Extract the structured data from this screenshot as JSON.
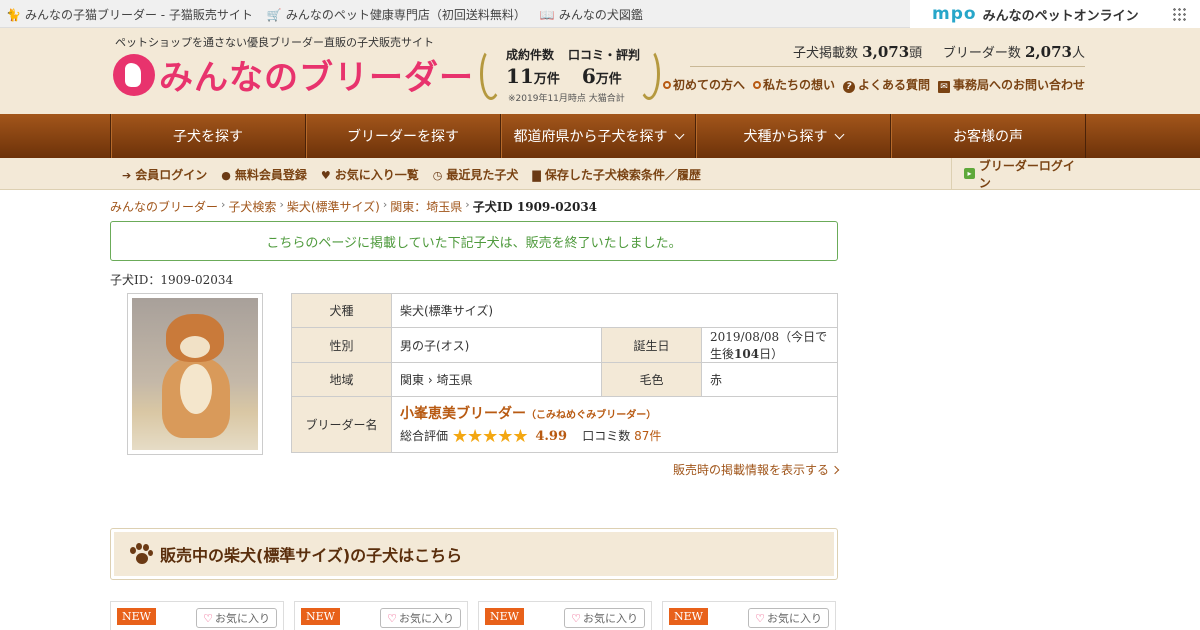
{
  "topbar": {
    "links": [
      {
        "label": "みんなの子猫ブリーダー - 子猫販売サイト",
        "icon": "cat-icon"
      },
      {
        "label": "みんなのペット健康専門店（初回送料無料）",
        "icon": "cart-icon"
      },
      {
        "label": "みんなの犬図鑑",
        "icon": "book-icon"
      }
    ],
    "mpo_logo": "mpo",
    "mpo_text": "みんなのペットオンライン"
  },
  "header": {
    "tagline": "ペットショップを通さない優良ブリーダー直販の子犬販売サイト",
    "brand": "みんなのブリーダー",
    "award": {
      "label1": "成約件数",
      "label2": "口コミ・評判",
      "num1": "11",
      "unit1": "万件",
      "num2": "6",
      "unit2": "万件",
      "note": "※2019年11月時点 大猫合計"
    },
    "counts": {
      "puppies_label": "子犬掲載数",
      "puppies": "3,073",
      "puppies_unit": "頭",
      "breeders_label": "ブリーダー数",
      "breeders": "2,073",
      "breeders_unit": "人"
    },
    "sublinks": [
      "初めての方へ",
      "私たちの想い",
      "よくある質問",
      "事務局へのお問い合わせ"
    ]
  },
  "nav": {
    "items": [
      "子犬を探す",
      "ブリーダーを探す",
      "都道府県から子犬を探す",
      "犬種から探す",
      "お客様の声"
    ]
  },
  "subnav": {
    "items": [
      "会員ログイン",
      "無料会員登録",
      "お気に入り一覧",
      "最近見た子犬",
      "保存した子犬検索条件／履歴"
    ],
    "breeder_login": "ブリーダーログイン"
  },
  "breadcrumb": [
    "みんなのブリーダー",
    "子犬検索",
    "柴犬(標準サイズ)",
    "関東：埼玉県"
  ],
  "breadcrumb_current": "子犬ID 1909-02034",
  "ended_message": "こちらのページに掲載していた下記子犬は、販売を終了いたしました。",
  "puppy_id": "子犬ID：1909-02034",
  "info": {
    "breed_label": "犬種",
    "breed": "柴犬(標準サイズ)",
    "sex_label": "性別",
    "sex": "男の子(オス)",
    "birth_label": "誕生日",
    "birth": "2019/08/08（今日で生後",
    "age_days": "104",
    "birth_suffix": "日）",
    "region_label": "地域",
    "region": "関東",
    "region_pref": "埼玉県",
    "color_label": "毛色",
    "color": "赤",
    "breeder_label": "ブリーダー名",
    "breeder_name": "小峯恵美ブリーダー",
    "breeder_kana": "（こみねめぐみブリーダー）",
    "rating_label": "総合評価",
    "stars": "★★★★★",
    "score": "4.99",
    "reviews_label": "口コミ数",
    "reviews": "87件"
  },
  "show_info_link": "販売時の掲載情報を表示する",
  "section_title": "販売中の柴犬(標準サイズ)の子犬はこちら",
  "cards": [
    {
      "badge": "NEW",
      "fav": "お気に入り"
    },
    {
      "badge": "NEW",
      "fav": "お気に入り"
    },
    {
      "badge": "NEW",
      "fav": "お気に入り"
    },
    {
      "badge": "NEW",
      "fav": "お気に入り"
    }
  ],
  "colors": {
    "brand": "#e8336d",
    "nav": "#8a4514",
    "accent": "#b85a12",
    "ended": "#4e9a3c",
    "star": "#f3a712"
  }
}
